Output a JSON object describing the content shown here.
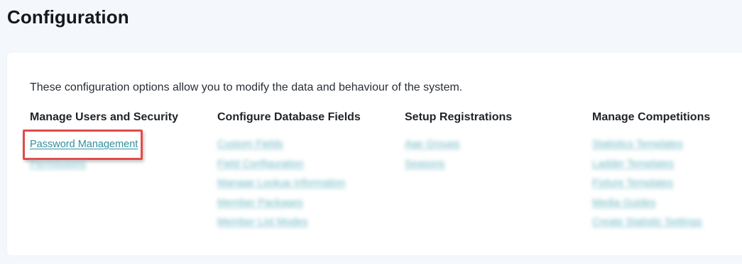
{
  "page": {
    "title": "Configuration"
  },
  "card": {
    "intro": "These configuration options allow you to modify the data and behaviour of the system."
  },
  "columns": [
    {
      "heading": "Manage Users and Security",
      "links": [
        "Password Management",
        "Permissions"
      ]
    },
    {
      "heading": "Configure Database Fields",
      "links": [
        "Custom Fields",
        "Field Configuration",
        "Manage Lookup Information",
        "Member Packages",
        "Member List Modes"
      ]
    },
    {
      "heading": "Setup Registrations",
      "links": [
        "Age Groups",
        "Seasons"
      ]
    },
    {
      "heading": "Manage Competitions",
      "links": [
        "Statistics Templates",
        "Ladder Templates",
        "Fixture Templates",
        "Media Guides",
        "Create Statistic Settings"
      ]
    }
  ],
  "colors": {
    "link": "#2f8f9d",
    "highlight_box": "#e34a4a",
    "background": "#f4f7fb"
  }
}
